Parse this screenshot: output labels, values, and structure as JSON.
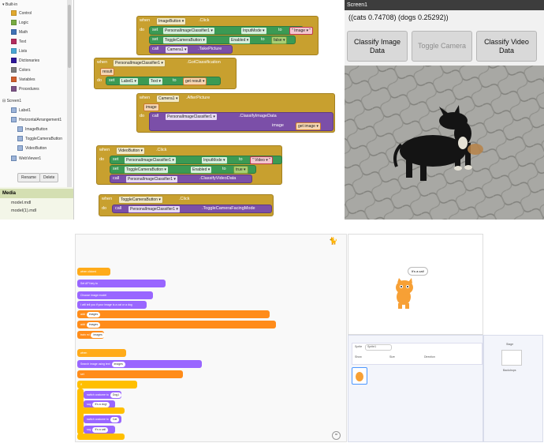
{
  "palette": {
    "builtin_label": "Built-in",
    "builtin_items": [
      {
        "label": "Control",
        "color": "#e1a92f"
      },
      {
        "label": "Logic",
        "color": "#77ab41"
      },
      {
        "label": "Math",
        "color": "#3f71b5"
      },
      {
        "label": "Text",
        "color": "#b32d5e"
      },
      {
        "label": "Lists",
        "color": "#49a6d4"
      },
      {
        "label": "Dictionaries",
        "color": "#2d1799"
      },
      {
        "label": "Colors",
        "color": "#7d7d7d"
      },
      {
        "label": "Variables",
        "color": "#d05f2d"
      },
      {
        "label": "Procedures",
        "color": "#7c5385"
      }
    ],
    "screen_label": "Screen1",
    "components": [
      "Label1",
      "HorizontalArrangement1",
      "ImageButton",
      "ToggleCameraButton",
      "VideoButton",
      "WebViewer1"
    ],
    "rename_button": "Rename",
    "delete_button": "Delete",
    "media_header": "Media",
    "media_files": [
      "model.mdl",
      "model(1).mdl"
    ]
  },
  "blocks": {
    "image_click": {
      "when": "when",
      "component": "ImageButton",
      "event": ".Click",
      "do": "do",
      "set": "set",
      "call": "call",
      "s1_comp": "PersonalImageClassifier1",
      "s1_prop": "InputMode",
      "to": "to",
      "s1_val": "Image",
      "s2_comp": "ToggleCameraButton",
      "s2_prop": "Enabled",
      "s2_val": "false",
      "call_comp": "Camera1",
      "call_method": ".TakePicture"
    },
    "got_class": {
      "when": "when",
      "component": "PersonalImageClassifier1",
      "event": ".GotClassification",
      "param": "result",
      "do": "do",
      "set": "set",
      "label": "Label1",
      "prop": "Text",
      "to": "to",
      "get": "get",
      "get_var": "result"
    },
    "after_pic": {
      "when": "when",
      "component": "Camera1",
      "event": ".AfterPicture",
      "param": "image",
      "do": "do",
      "call": "call",
      "comp": "PersonalImageClassifier1",
      "method": ".ClassifyImageData",
      "arg": "image",
      "get": "get",
      "get_var": "image"
    },
    "video_click": {
      "when": "when",
      "component": "VideoButton",
      "event": ".Click",
      "do": "do",
      "set": "set",
      "call": "call",
      "s1_comp": "PersonalImageClassifier1",
      "s1_prop": "InputMode",
      "to": "to",
      "s1_val": "Video",
      "s2_comp": "ToggleCameraButton",
      "s2_prop": "Enabled",
      "s2_val": "true",
      "call_comp": "PersonalImageClassifier1",
      "call_method": ".ClassifyVideoData"
    },
    "toggle_click": {
      "when": "when",
      "component": "ToggleCameraButton",
      "event": ".Click",
      "do": "do",
      "call": "call",
      "comp": "PersonalImageClassifier1",
      "method": ".ToggleCameraFacingMode"
    }
  },
  "phone": {
    "title": "Screen1",
    "result": "((cats 0.74708) (dogs 0.25292))",
    "btn_classify_image": "Classify Image Data",
    "btn_toggle_camera": "Toggle Camera",
    "btn_classify_video": "Classify Video Data"
  },
  "scratch": {
    "blocks": [
      "when clicked",
      "Set API key to",
      "Choose image model",
      "I will tell you if your image is a cat or a dog",
      "add",
      "add",
      "train ml",
      "when",
      "Search image using text",
      "set",
      "if",
      "switch costume to",
      "say",
      "switch costume to",
      "say"
    ],
    "costume_dog": "Dog1",
    "costume_cat": "Cat",
    "say_dog": "It's a dog!",
    "say_cat": "It's a cat!",
    "images_label": "images",
    "speech": "It's a cat!",
    "sprite_label": "Sprite",
    "sprite_name": "Sprite1",
    "show_label": "Show",
    "size_label": "Size",
    "direction_label": "Direction",
    "stage_label": "Stage",
    "backdrops_label": "Backdrops"
  }
}
